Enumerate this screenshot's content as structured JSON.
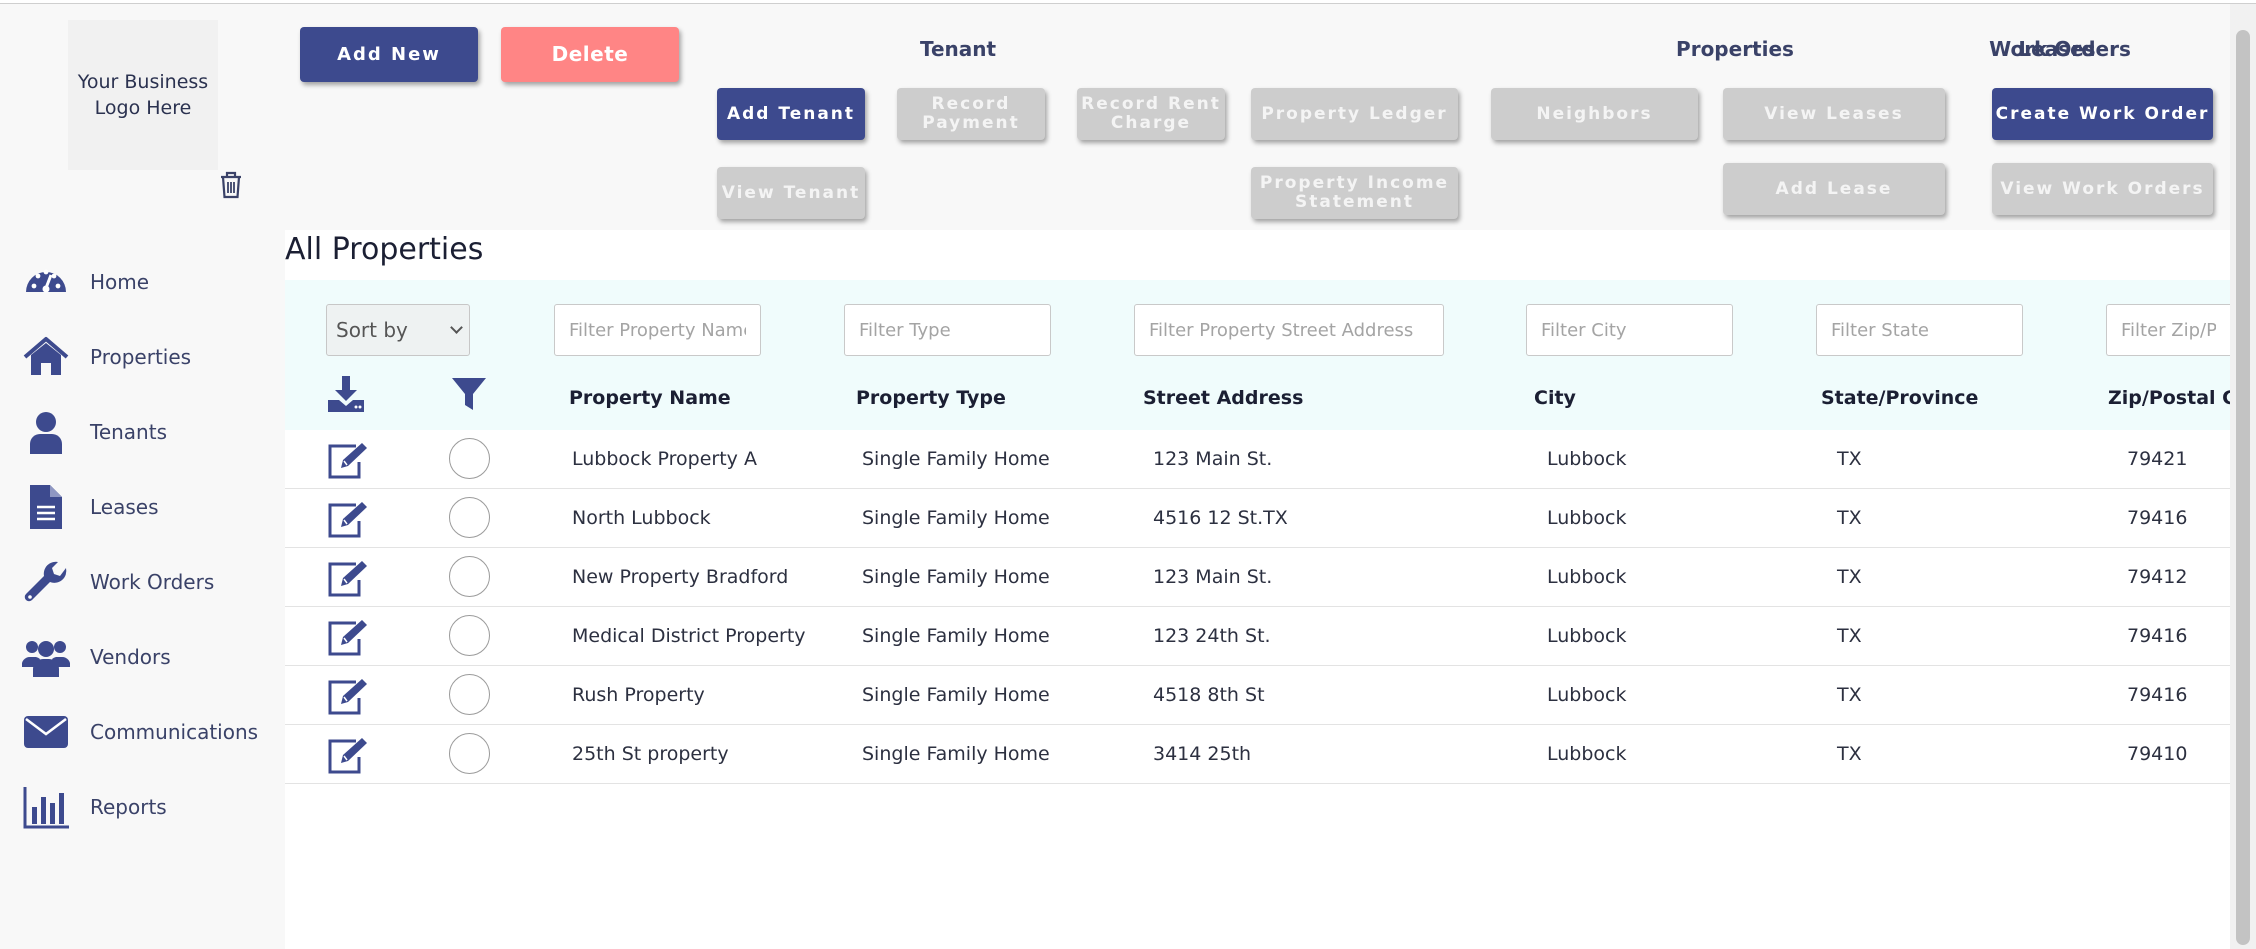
{
  "sidebar": {
    "logo_text": "Your Business Logo Here",
    "items": [
      {
        "label": "Home",
        "icon": "speedometer-icon"
      },
      {
        "label": "Properties",
        "icon": "house-icon"
      },
      {
        "label": "Tenants",
        "icon": "user-icon"
      },
      {
        "label": "Leases",
        "icon": "document-icon"
      },
      {
        "label": "Work Orders",
        "icon": "wrench-icon"
      },
      {
        "label": "Vendors",
        "icon": "users-group-icon"
      },
      {
        "label": "Communications",
        "icon": "envelope-icon"
      },
      {
        "label": "Reports",
        "icon": "bar-chart-icon"
      }
    ]
  },
  "toolbar": {
    "add_new": "Add New",
    "delete": "Delete",
    "groups": {
      "tenant": "Tenant",
      "properties": "Properties",
      "leases": "Leases",
      "work_orders": "Work Orders"
    },
    "buttons": {
      "add_tenant": "Add Tenant",
      "record_payment": "Record Payment",
      "record_rent_charge": "Record Rent Charge",
      "view_tenant": "View Tenant",
      "property_ledger": "Property Ledger",
      "neighbors": "Neighbors",
      "property_income_statement": "Property Income Statement",
      "view_leases": "View Leases",
      "add_lease": "Add Lease",
      "create_work_order": "Create Work Order",
      "view_work_orders": "View Work Orders"
    }
  },
  "page": {
    "title": "All Properties"
  },
  "filters": {
    "sort_by": "Sort by",
    "property_name": "Filter Property Name",
    "type": "Filter Type",
    "street_address": "Filter Property Street Address",
    "city": "Filter City",
    "state": "Filter State",
    "zip": "Filter Zip/Postal Code"
  },
  "table": {
    "headers": {
      "name": "Property Name",
      "type": "Property Type",
      "address": "Street Address",
      "city": "City",
      "state": "State/Province",
      "zip": "Zip/Postal Code"
    },
    "rows": [
      {
        "name": "Lubbock Property A",
        "type": "Single Family Home",
        "address": "123 Main St.",
        "city": "Lubbock",
        "state": "TX",
        "zip": "79421"
      },
      {
        "name": "North Lubbock",
        "type": "Single Family Home",
        "address": "4516 12 St.TX",
        "city": "Lubbock",
        "state": "TX",
        "zip": "79416"
      },
      {
        "name": "New Property Bradford",
        "type": "Single Family Home",
        "address": "123 Main St.",
        "city": "Lubbock",
        "state": "TX",
        "zip": "79412"
      },
      {
        "name": "Medical District Property",
        "type": "Single Family Home",
        "address": "123 24th St.",
        "city": "Lubbock",
        "state": "TX",
        "zip": "79416"
      },
      {
        "name": "Rush Property",
        "type": "Single Family Home",
        "address": "4518 8th St",
        "city": "Lubbock",
        "state": "TX",
        "zip": "79416"
      },
      {
        "name": "25th St property",
        "type": "Single Family Home",
        "address": "3414 25th",
        "city": "Lubbock",
        "state": "TX",
        "zip": "79410"
      }
    ]
  },
  "colors": {
    "primary": "#3d4a8e",
    "danger": "#ff8585",
    "disabled": "#cdcdcd",
    "filter_bg": "#f0fcfc"
  }
}
